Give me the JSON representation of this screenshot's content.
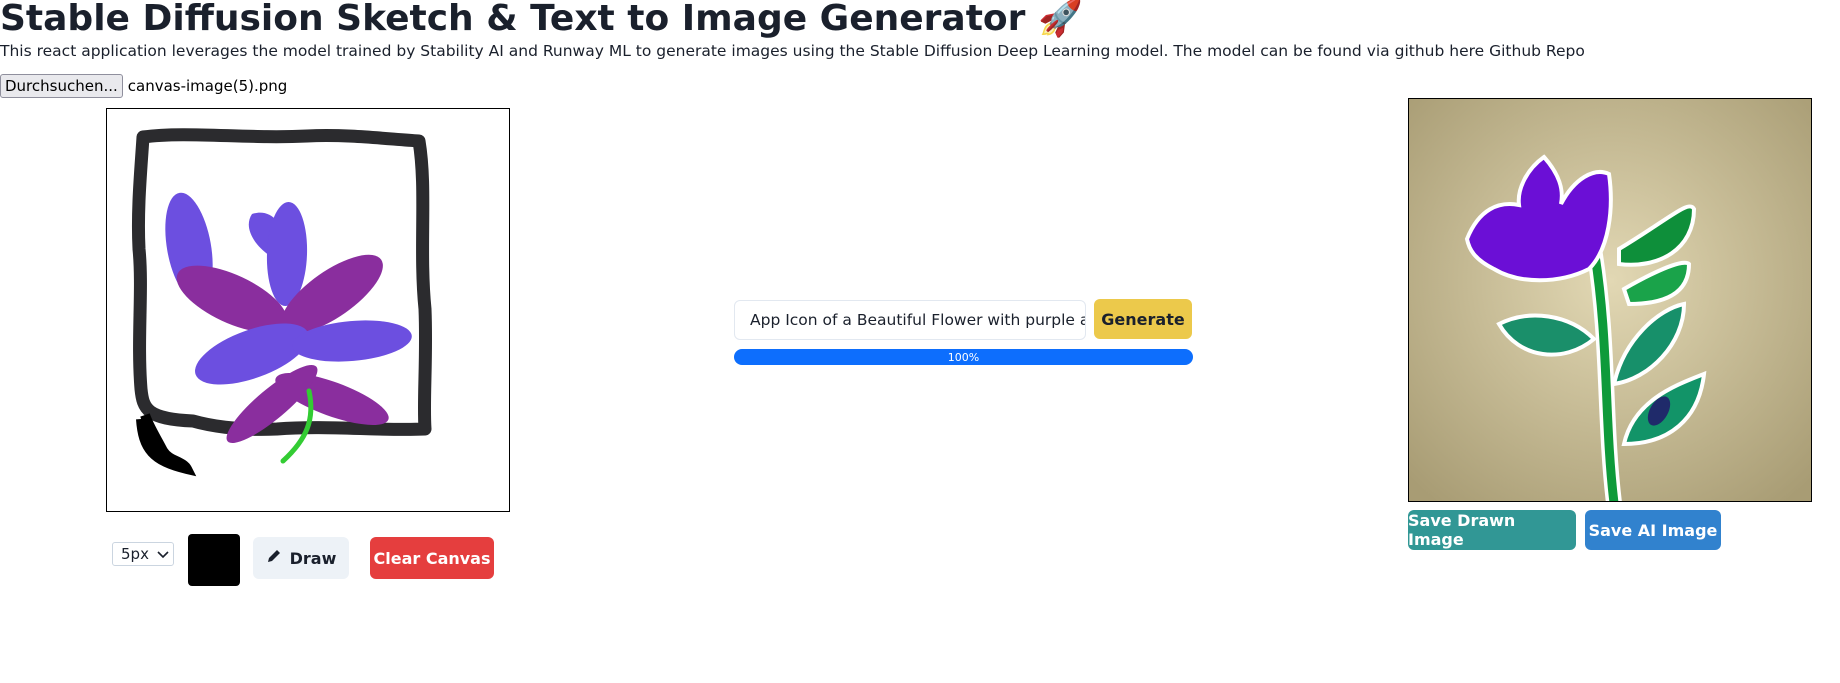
{
  "header": {
    "title": "Stable Diffusion Sketch & Text to Image Generator 🚀",
    "description": "This react application leverages the model trained by Stability AI and Runway ML to generate images using the Stable Diffusion Deep Learning model. The model can be found via github here Github Repo"
  },
  "file_input": {
    "button_label": "Durchsuchen...",
    "file_name": "canvas-image(5).png"
  },
  "sketch": {
    "brush_size": "5px",
    "brush_color": "#000000",
    "draw_label": "Draw",
    "clear_label": "Clear Canvas"
  },
  "generator": {
    "prompt_value": "App Icon of a Beautiful Flower with purple and",
    "generate_label": "Generate",
    "progress_value": 100,
    "progress_text": "100%"
  },
  "output": {
    "save_drawn_label": "Save Drawn Image",
    "save_ai_label": "Save AI Image"
  },
  "colors": {
    "generate": "#ecc94b",
    "clear": "#e53e3e",
    "save_drawn": "#319795",
    "save_ai": "#3182ce",
    "progress": "#0d6efd"
  }
}
